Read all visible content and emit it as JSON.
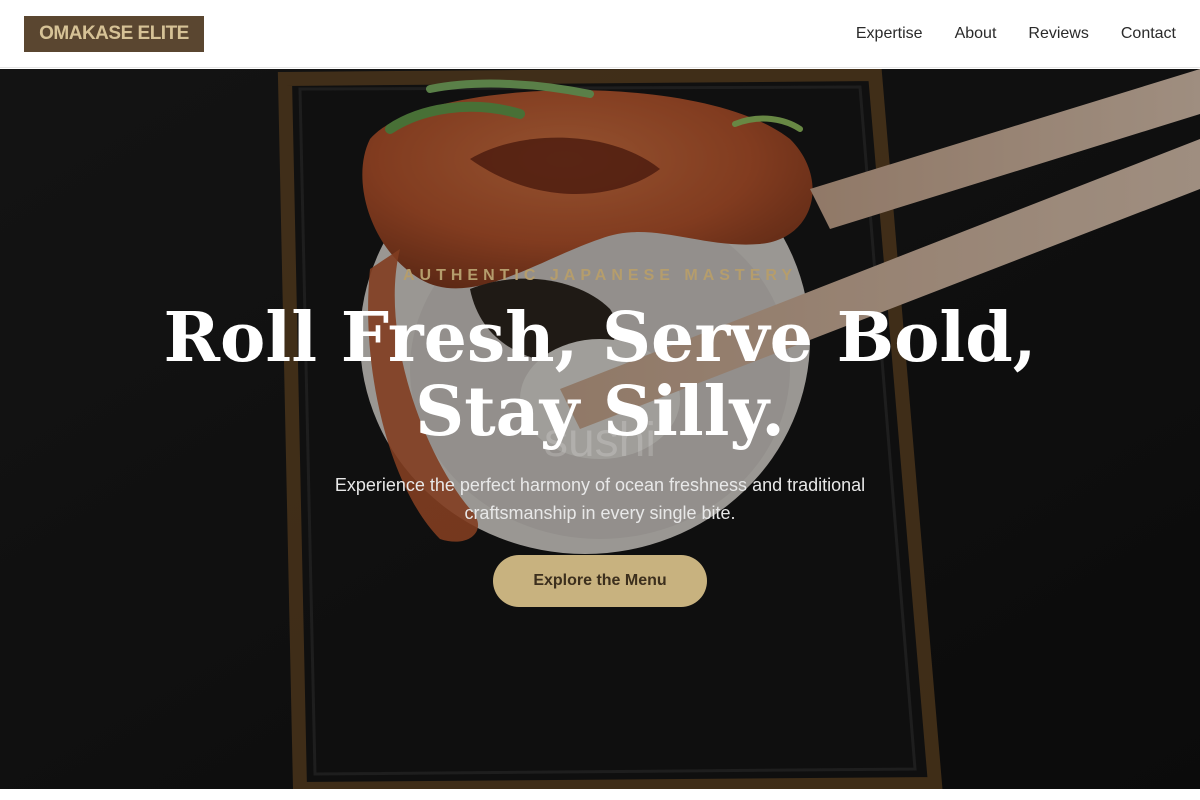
{
  "brand": {
    "name": "OMAKASE ELITE",
    "bg_color": "#5a4630",
    "text_color": "#d6c296"
  },
  "nav": {
    "items": [
      {
        "label": "Expertise"
      },
      {
        "label": "About"
      },
      {
        "label": "Reviews"
      },
      {
        "label": "Contact"
      }
    ]
  },
  "hero": {
    "eyebrow": "AUTHENTIC JAPANESE MASTERY",
    "headline_line1": "Roll Fresh, Serve Bold,",
    "headline_line2": "Stay Silly.",
    "ghost_text": "sushi",
    "subtitle": "Experience the perfect harmony of ocean freshness and traditional craftsmanship in every single bite.",
    "cta_label": "Explore the Menu",
    "accent_color": "#c8b27f"
  }
}
